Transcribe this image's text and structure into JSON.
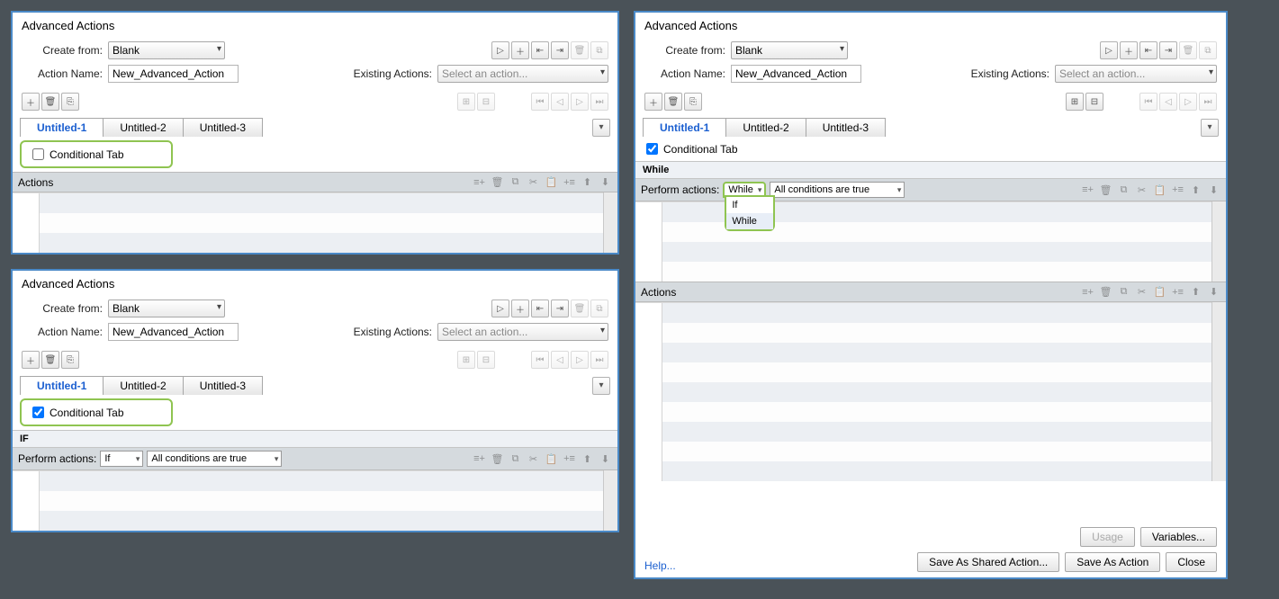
{
  "title": "Advanced Actions",
  "labels": {
    "create_from": "Create from:",
    "action_name": "Action Name:",
    "existing_actions": "Existing Actions:",
    "conditional_tab": "Conditional Tab",
    "actions": "Actions",
    "perform_actions": "Perform actions:",
    "if_hdr": "IF",
    "while_hdr": "While",
    "help": "Help...",
    "usage": "Usage",
    "variables": "Variables...",
    "save_shared": "Save As Shared Action...",
    "save_action": "Save As Action",
    "close": "Close"
  },
  "values": {
    "create_from": "Blank",
    "action_name": "New_Advanced_Action",
    "existing_placeholder": "Select an action...",
    "condition_select": "All conditions are true"
  },
  "tabs": [
    {
      "label": "Untitled-1",
      "active": true
    },
    {
      "label": "Untitled-2",
      "active": false
    },
    {
      "label": "Untitled-3",
      "active": false
    }
  ],
  "perform_mode_if": "If",
  "perform_mode_while": "While",
  "dropdown_options": [
    "If",
    "While"
  ]
}
